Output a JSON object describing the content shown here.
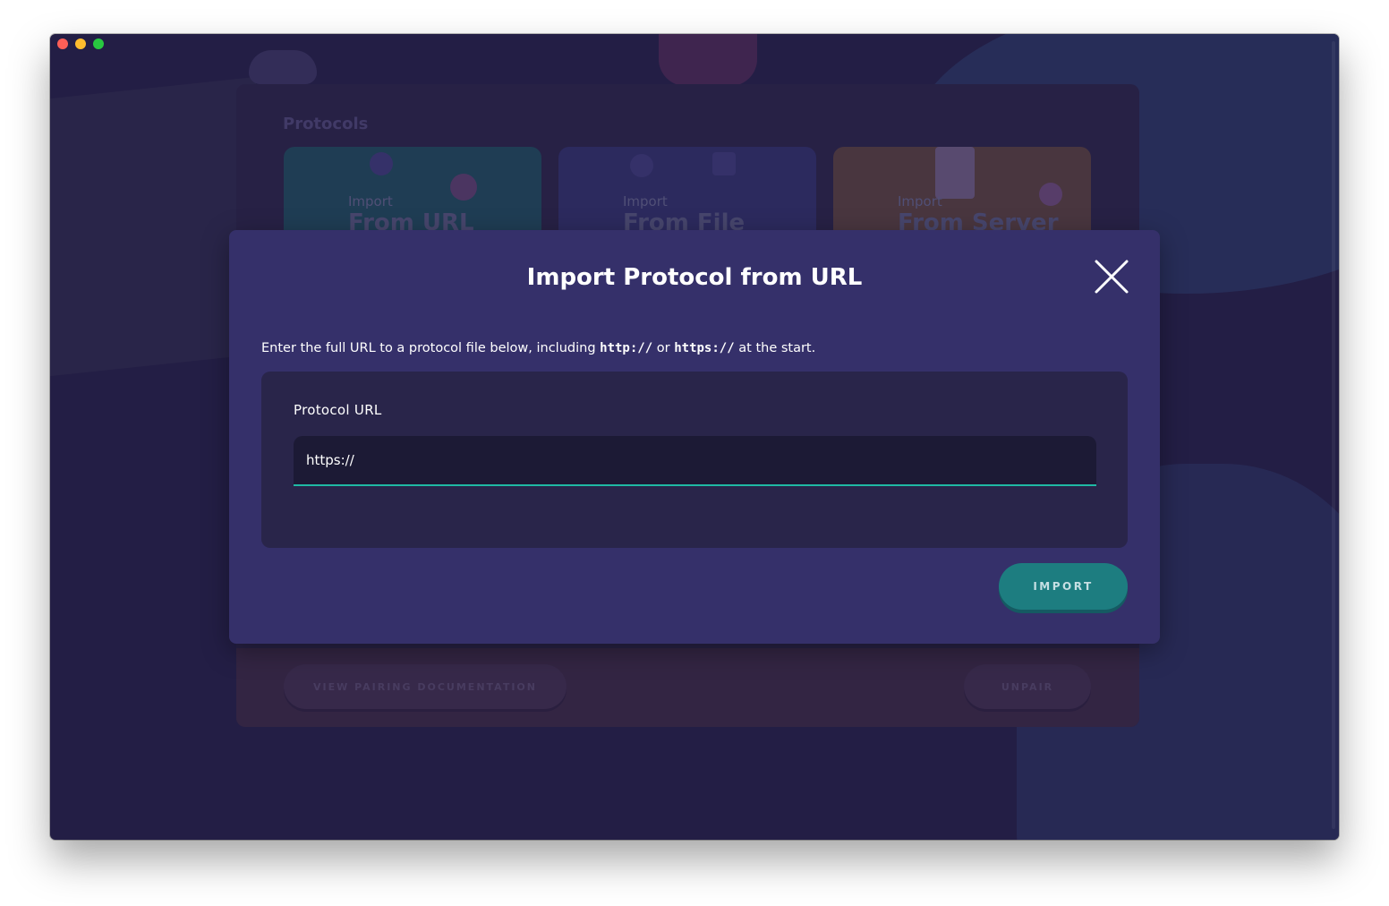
{
  "page": {
    "heading": "Protocols",
    "tiles": [
      {
        "top": "Import",
        "big": "From URL"
      },
      {
        "top": "Import",
        "big": "From File"
      },
      {
        "top": "Import",
        "big": "From Server"
      }
    ],
    "footer": {
      "doc_button": "VIEW PAIRING DOCUMENTATION",
      "unpair_button": "UNPAIR"
    }
  },
  "modal": {
    "title": "Import Protocol from URL",
    "desc_prefix": "Enter the full URL to a protocol file below, including ",
    "desc_code1": "http://",
    "desc_mid": " or ",
    "desc_code2": "https://",
    "desc_suffix": " at the start.",
    "field_label": "Protocol URL",
    "field_value": "https://",
    "import_button": "IMPORT"
  },
  "colors": {
    "accent": "#1fb9a4",
    "button": "#1d7d80",
    "modal_bg": "#35306a",
    "window_bg": "#252048"
  },
  "icons": {
    "close": "close-icon"
  }
}
